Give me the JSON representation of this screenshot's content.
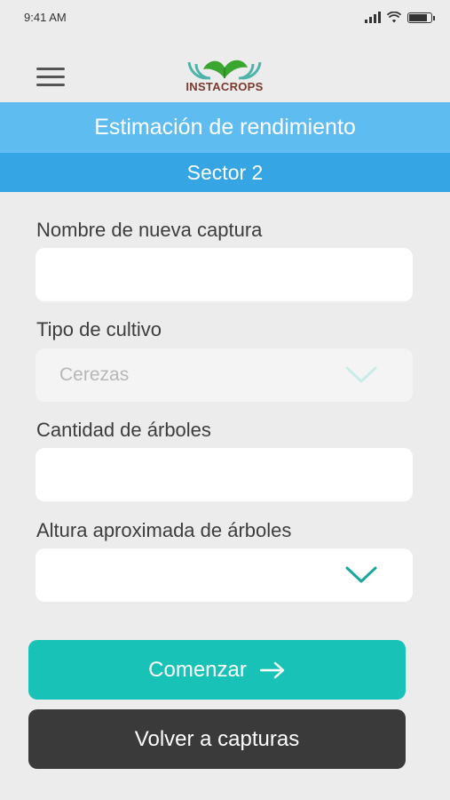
{
  "status_bar": {
    "time": "9:41 AM"
  },
  "app": {
    "logo_text": "INSTACROPS"
  },
  "header": {
    "title": "Estimación de rendimiento",
    "subtitle": "Sector 2"
  },
  "form": {
    "capture_name": {
      "label": "Nombre de nueva captura",
      "value": ""
    },
    "crop_type": {
      "label": "Tipo de cultivo",
      "value": "Cerezas",
      "disabled": true
    },
    "tree_count": {
      "label": "Cantidad de árboles",
      "value": ""
    },
    "tree_height": {
      "label": "Altura aproximada de árboles",
      "value": ""
    }
  },
  "actions": {
    "start_label": "Comenzar",
    "back_label": "Volver a capturas"
  },
  "colors": {
    "title_band": "#5ebcf0",
    "subtitle_band": "#36a5e4",
    "primary_button": "#19c2b6",
    "secondary_button": "#3a3a3a",
    "chevron_active": "#19a89b",
    "chevron_disabled": "#c9ece8",
    "logo_green": "#3aa62f",
    "logo_brown": "#7a3b2e",
    "logo_teal": "#4fb3a9"
  },
  "icons": {
    "menu": "hamburger-icon",
    "start_arrow": "arrow-right-icon",
    "select_chevron": "chevron-down-icon"
  }
}
